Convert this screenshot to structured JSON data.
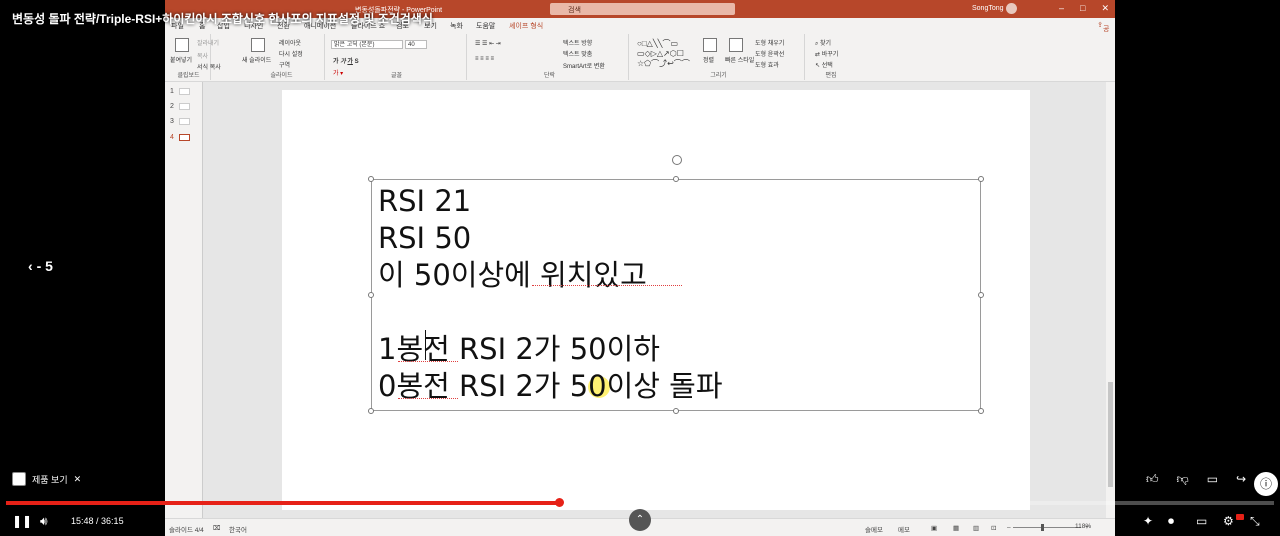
{
  "video": {
    "title": "변동성 돌파 전략/Triple-RSI+하이킨아시 조합신호 한사포의 지표설정 및 조건검색식",
    "back_label": "- 5",
    "products_label": "제품 보기",
    "current_time": "15:48",
    "duration": "36:15",
    "time_sep": " / ",
    "progress_fraction": 0.436,
    "buffered_fraction": 0.59
  },
  "ppt": {
    "doc_title": "변동성돌파전략 - PowerPoint",
    "search_placeholder": "검색",
    "user_name": "SongTong",
    "share_label": "공유",
    "tabs": [
      "파일",
      "홈",
      "삽입",
      "디자인",
      "전환",
      "애니메이션",
      "슬라이드 쇼",
      "검토",
      "보기",
      "녹화",
      "도움말",
      "셰이프 형식"
    ],
    "ribbon": {
      "clipboard": {
        "paste": "붙여넣기",
        "cut": "잘라내기",
        "copy": "복사",
        "format": "서식 복사",
        "label": "클립보드"
      },
      "slides": {
        "new": "새 슬라이드",
        "layout": "레이아웃",
        "reset": "다시 설정",
        "section": "구역",
        "label": "슬라이드"
      },
      "font": {
        "family": "맑은 고딕 (본문)",
        "size": "40",
        "label": "글꼴"
      },
      "paragraph": {
        "text_dir": "텍스트 방향",
        "align_text": "텍스트 맞춤",
        "smartart": "SmartArt로 변환",
        "label": "단락"
      },
      "drawing": {
        "arrange": "정렬",
        "quick_styles": "빠른 스타일",
        "fill": "도형 채우기",
        "outline": "도형 윤곽선",
        "effects": "도형 효과",
        "label": "그리기"
      },
      "editing": {
        "find": "찾기",
        "replace": "바꾸기",
        "select": "선택",
        "label": "편집"
      }
    },
    "slides": [
      {
        "num": "1",
        "active": false
      },
      {
        "num": "2",
        "active": false
      },
      {
        "num": "3",
        "active": false
      },
      {
        "num": "4",
        "active": true
      }
    ],
    "slide_text": {
      "line1": "RSI 21",
      "line2": "RSI 50",
      "line3": "이 50이상에 위치있고",
      "line4": "",
      "line5": "1봉전 RSI 2가 50이하",
      "line6": "0봉전 RSI 2가 50이상 돌파"
    },
    "status": {
      "slide_info": "슬라이드 4/4",
      "language": "한국어",
      "notes": "슬메모",
      "comments": "메모",
      "zoom": "118%"
    }
  }
}
